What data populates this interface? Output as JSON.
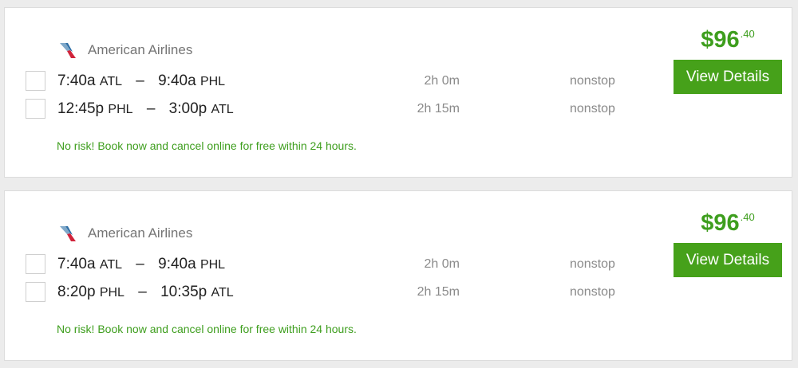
{
  "colors": {
    "accent_green": "#46a11a",
    "price_green": "#3e9e1e",
    "muted_text": "#8a8a8a"
  },
  "results": [
    {
      "airline": "American Airlines",
      "airline_icon": "american-airlines-logo-icon",
      "price_dollars": "$96",
      "price_cents": ".40",
      "button_label": "View Details",
      "legs": [
        {
          "depart_time": "7:40a",
          "depart_code": "ATL",
          "separator": "–",
          "arrive_time": "9:40a",
          "arrive_code": "PHL",
          "duration": "2h 0m",
          "stops": "nonstop"
        },
        {
          "depart_time": "12:45p",
          "depart_code": "PHL",
          "separator": "–",
          "arrive_time": "3:00p",
          "arrive_code": "ATL",
          "duration": "2h 15m",
          "stops": "nonstop"
        }
      ],
      "promo": "No risk! Book now and cancel online for free within 24 hours."
    },
    {
      "airline": "American Airlines",
      "airline_icon": "american-airlines-logo-icon",
      "price_dollars": "$96",
      "price_cents": ".40",
      "button_label": "View Details",
      "legs": [
        {
          "depart_time": "7:40a",
          "depart_code": "ATL",
          "separator": "–",
          "arrive_time": "9:40a",
          "arrive_code": "PHL",
          "duration": "2h 0m",
          "stops": "nonstop"
        },
        {
          "depart_time": "8:20p",
          "depart_code": "PHL",
          "separator": "–",
          "arrive_time": "10:35p",
          "arrive_code": "ATL",
          "duration": "2h 15m",
          "stops": "nonstop"
        }
      ],
      "promo": "No risk! Book now and cancel online for free within 24 hours."
    }
  ]
}
